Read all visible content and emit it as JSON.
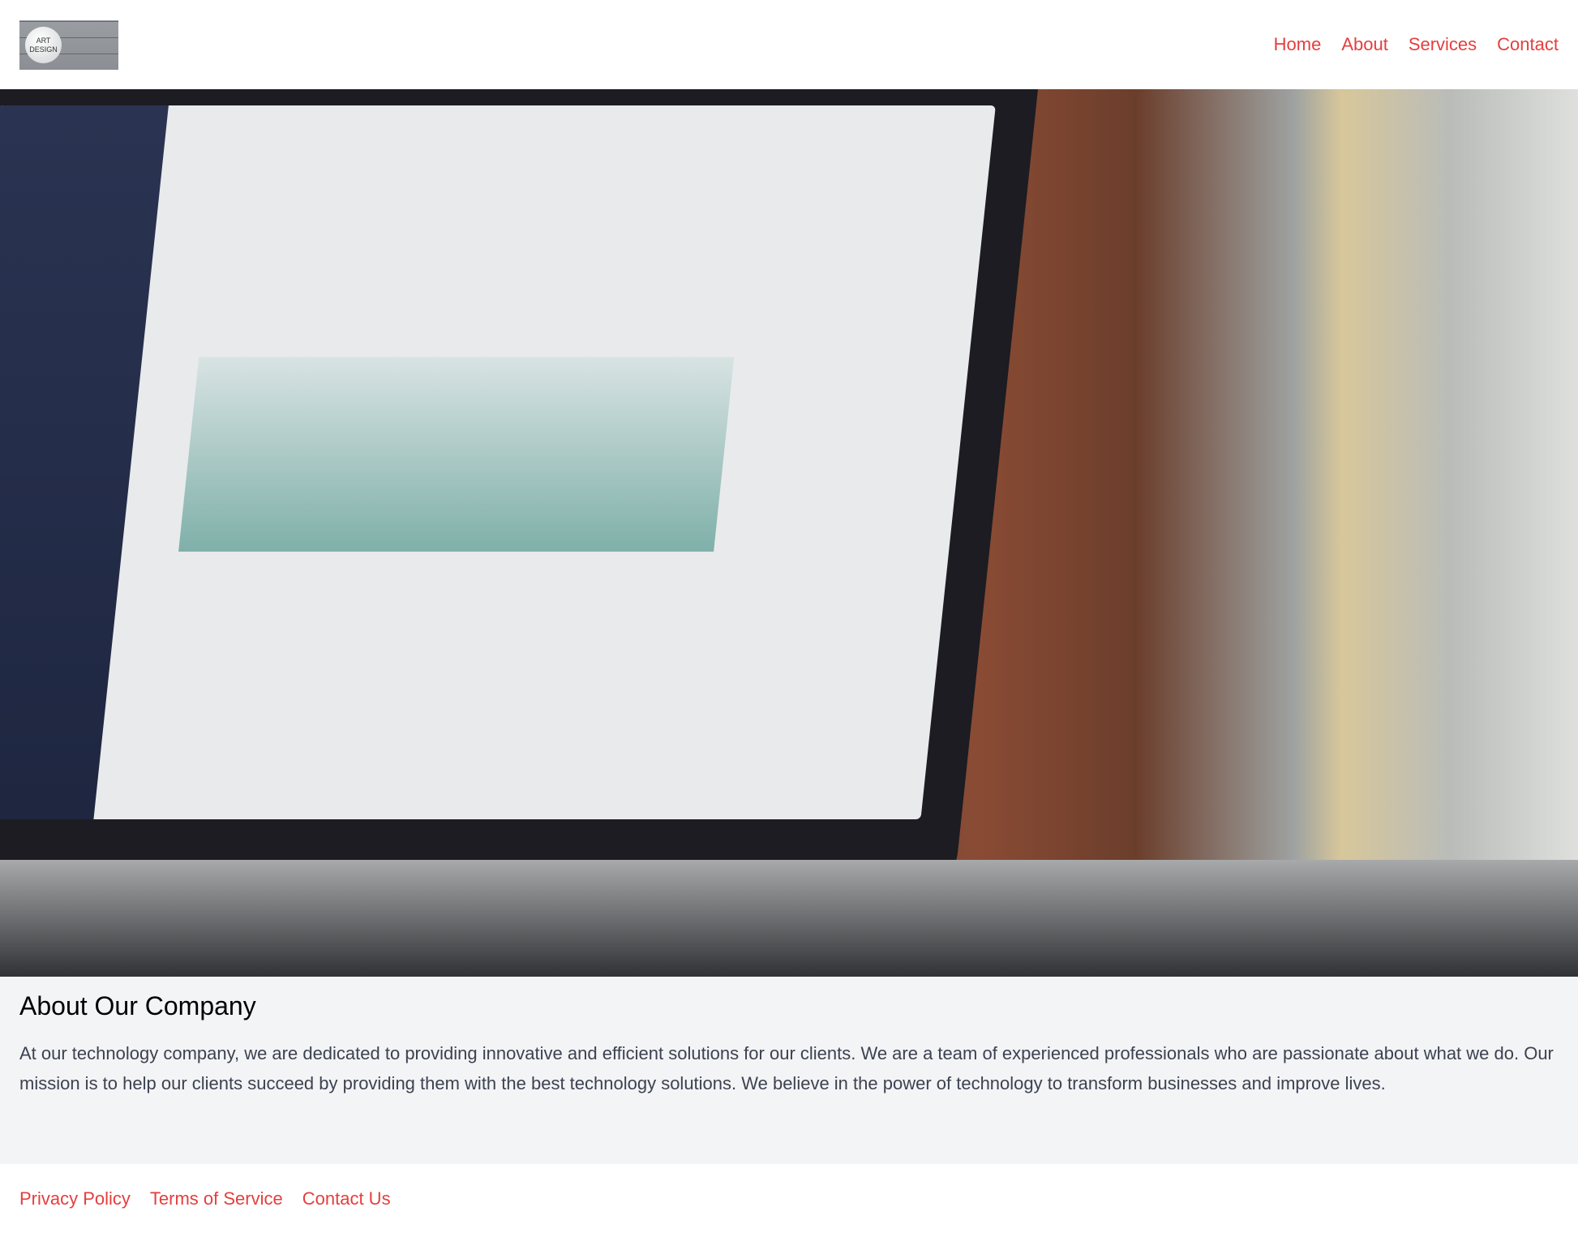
{
  "header": {
    "logo_text": "ART DESIGN",
    "nav": [
      {
        "label": "Home"
      },
      {
        "label": "About"
      },
      {
        "label": "Services"
      },
      {
        "label": "Contact"
      }
    ]
  },
  "hero": {
    "image": "laptop-analytics-dashboard-photo"
  },
  "about": {
    "title": "About Our Company",
    "body": "At our technology company, we are dedicated to providing innovative and efficient solutions for our clients. We are a team of experienced professionals who are passionate about what we do. Our mission is to help our clients succeed by providing them with the best technology solutions. We believe in the power of technology to transform businesses and improve lives."
  },
  "footer": {
    "links": [
      {
        "label": "Privacy Policy"
      },
      {
        "label": "Terms of Service"
      },
      {
        "label": "Contact Us"
      }
    ]
  },
  "colors": {
    "link": "#e53e3e",
    "section_bg": "#f3f4f6"
  }
}
